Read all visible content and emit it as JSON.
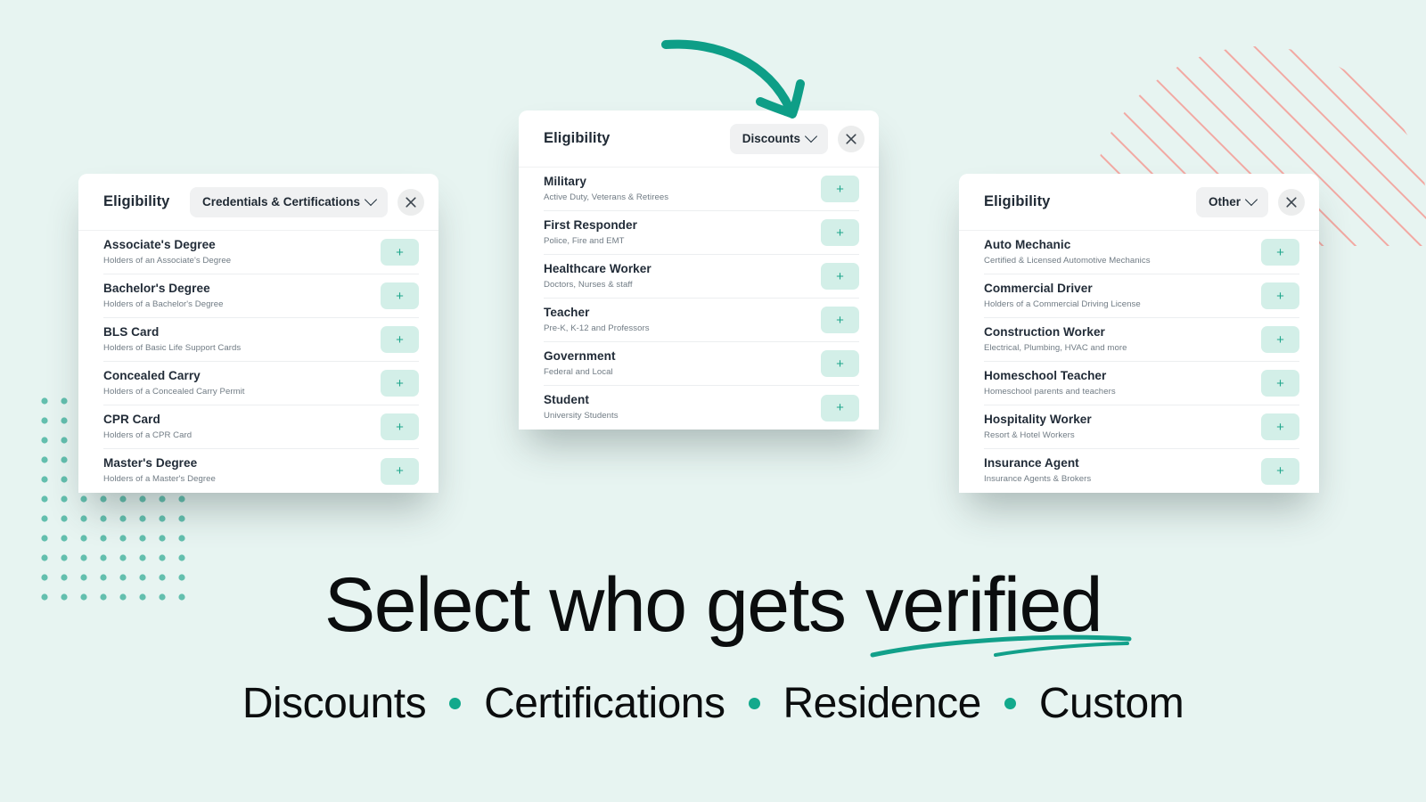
{
  "theme": {
    "background": "#e7f4f1",
    "accent_teal": "#12a98c",
    "plus_button_bg": "#d3efe8",
    "plus_button_fg": "#1fa68b",
    "pill_bg": "#f0f1f2",
    "hatch_pink": "#f2a9a3",
    "dot_teal": "#63bfae",
    "text_dark": "#222c38",
    "text_muted": "#707b84"
  },
  "cards": [
    {
      "title": "Eligibility",
      "dropdown_label": "Credentials & Certifications",
      "close_label": "Close",
      "rows": [
        {
          "name": "Associate's Degree",
          "sub": "Holders of an Associate's Degree",
          "add_label": "+"
        },
        {
          "name": "Bachelor's Degree",
          "sub": "Holders of a Bachelor's Degree",
          "add_label": "+"
        },
        {
          "name": "BLS Card",
          "sub": "Holders of Basic Life Support Cards",
          "add_label": "+"
        },
        {
          "name": "Concealed Carry",
          "sub": "Holders of a Concealed Carry Permit",
          "add_label": "+"
        },
        {
          "name": "CPR Card",
          "sub": "Holders of a CPR Card",
          "add_label": "+"
        },
        {
          "name": "Master's Degree",
          "sub": "Holders of a Master's Degree",
          "add_label": "+"
        }
      ]
    },
    {
      "title": "Eligibility",
      "dropdown_label": "Discounts",
      "close_label": "Close",
      "rows": [
        {
          "name": "Military",
          "sub": "Active Duty, Veterans & Retirees",
          "add_label": "+"
        },
        {
          "name": "First Responder",
          "sub": "Police, Fire and EMT",
          "add_label": "+"
        },
        {
          "name": "Healthcare Worker",
          "sub": "Doctors, Nurses & staff",
          "add_label": "+"
        },
        {
          "name": "Teacher",
          "sub": "Pre-K, K-12 and Professors",
          "add_label": "+"
        },
        {
          "name": "Government",
          "sub": "Federal and Local",
          "add_label": "+"
        },
        {
          "name": "Student",
          "sub": "University Students",
          "add_label": "+"
        }
      ]
    },
    {
      "title": "Eligibility",
      "dropdown_label": "Other",
      "close_label": "Close",
      "rows": [
        {
          "name": "Auto Mechanic",
          "sub": "Certified & Licensed Automotive Mechanics",
          "add_label": "+"
        },
        {
          "name": "Commercial Driver",
          "sub": "Holders of a Commercial Driving License",
          "add_label": "+"
        },
        {
          "name": "Construction Worker",
          "sub": "Electrical, Plumbing, HVAC and more",
          "add_label": "+"
        },
        {
          "name": "Homeschool Teacher",
          "sub": "Homeschool parents and teachers",
          "add_label": "+"
        },
        {
          "name": "Hospitality Worker",
          "sub": "Resort & Hotel Workers",
          "add_label": "+"
        },
        {
          "name": "Insurance Agent",
          "sub": "Insurance Agents & Brokers",
          "add_label": "+"
        }
      ]
    }
  ],
  "headline": "Select who gets verified",
  "tagline": {
    "items": [
      "Discounts",
      "Certifications",
      "Residence",
      "Custom"
    ]
  }
}
